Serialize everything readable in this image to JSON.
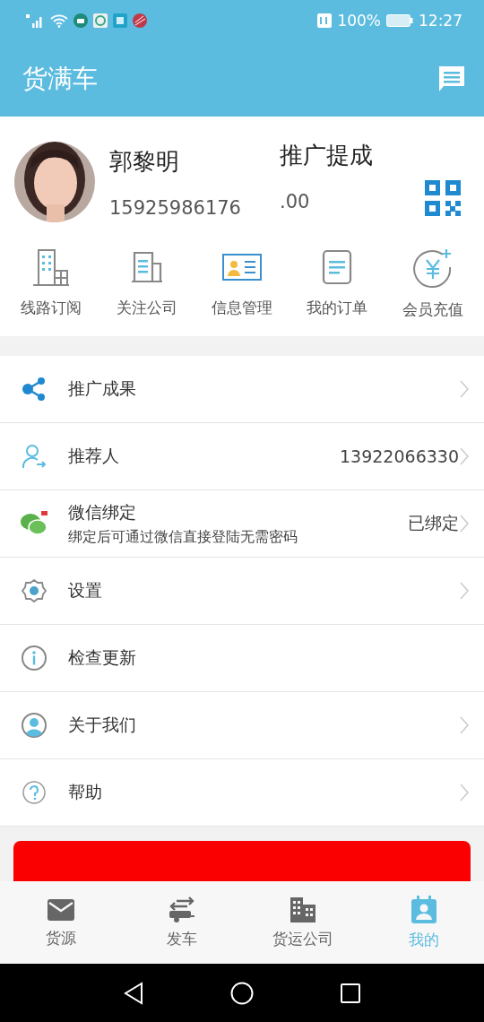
{
  "status_bar": {
    "battery": "100%",
    "time": "12:27"
  },
  "app_bar": {
    "title": "货满车"
  },
  "profile": {
    "name": "郭黎明",
    "phone": "15925986176",
    "commission_label": "推广提成",
    "commission_value": ".00"
  },
  "shortcuts": [
    {
      "label": "线路订阅"
    },
    {
      "label": "关注公司"
    },
    {
      "label": "信息管理"
    },
    {
      "label": "我的订单"
    },
    {
      "label": "会员充值"
    }
  ],
  "menu": [
    {
      "label": "推广成果",
      "chevron": true
    },
    {
      "label": "推荐人",
      "value": "13922066330",
      "chevron": true
    },
    {
      "label": "微信绑定",
      "subtitle": "绑定后可通过微信直接登陆无需密码",
      "value": "已绑定",
      "chevron": true
    },
    {
      "label": "设置",
      "chevron": true
    },
    {
      "label": "检查更新",
      "chevron": false
    },
    {
      "label": "关于我们",
      "chevron": true
    },
    {
      "label": "帮助",
      "chevron": true
    }
  ],
  "tabs": [
    {
      "label": "货源",
      "selected": false
    },
    {
      "label": "发车",
      "selected": false
    },
    {
      "label": "货运公司",
      "selected": false
    },
    {
      "label": "我的",
      "selected": true
    }
  ]
}
